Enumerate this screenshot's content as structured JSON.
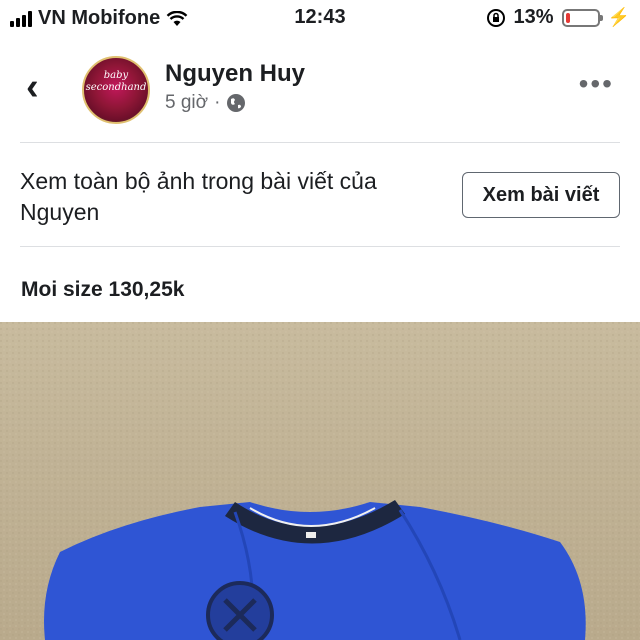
{
  "status_bar": {
    "carrier": "VN Mobifone",
    "time": "12:43",
    "battery_percent_text": "13%",
    "battery_level": 0.13,
    "battery_color": "#e53935"
  },
  "post_header": {
    "author_name": "Nguyen Huy",
    "time_ago": "5 giờ",
    "separator": "·",
    "avatar_text_1": "baby",
    "avatar_text_2": "secondhand",
    "privacy_icon": "globe-icon"
  },
  "view_all": {
    "prompt": "Xem toàn bộ ảnh trong bài viết của Nguyen",
    "button_label": "Xem bài viết"
  },
  "post": {
    "caption": "Moi size 130,25k"
  },
  "colors": {
    "shirt_blue": "#2f55d4",
    "collar": "#1d2740",
    "sand": "#c3b597"
  }
}
